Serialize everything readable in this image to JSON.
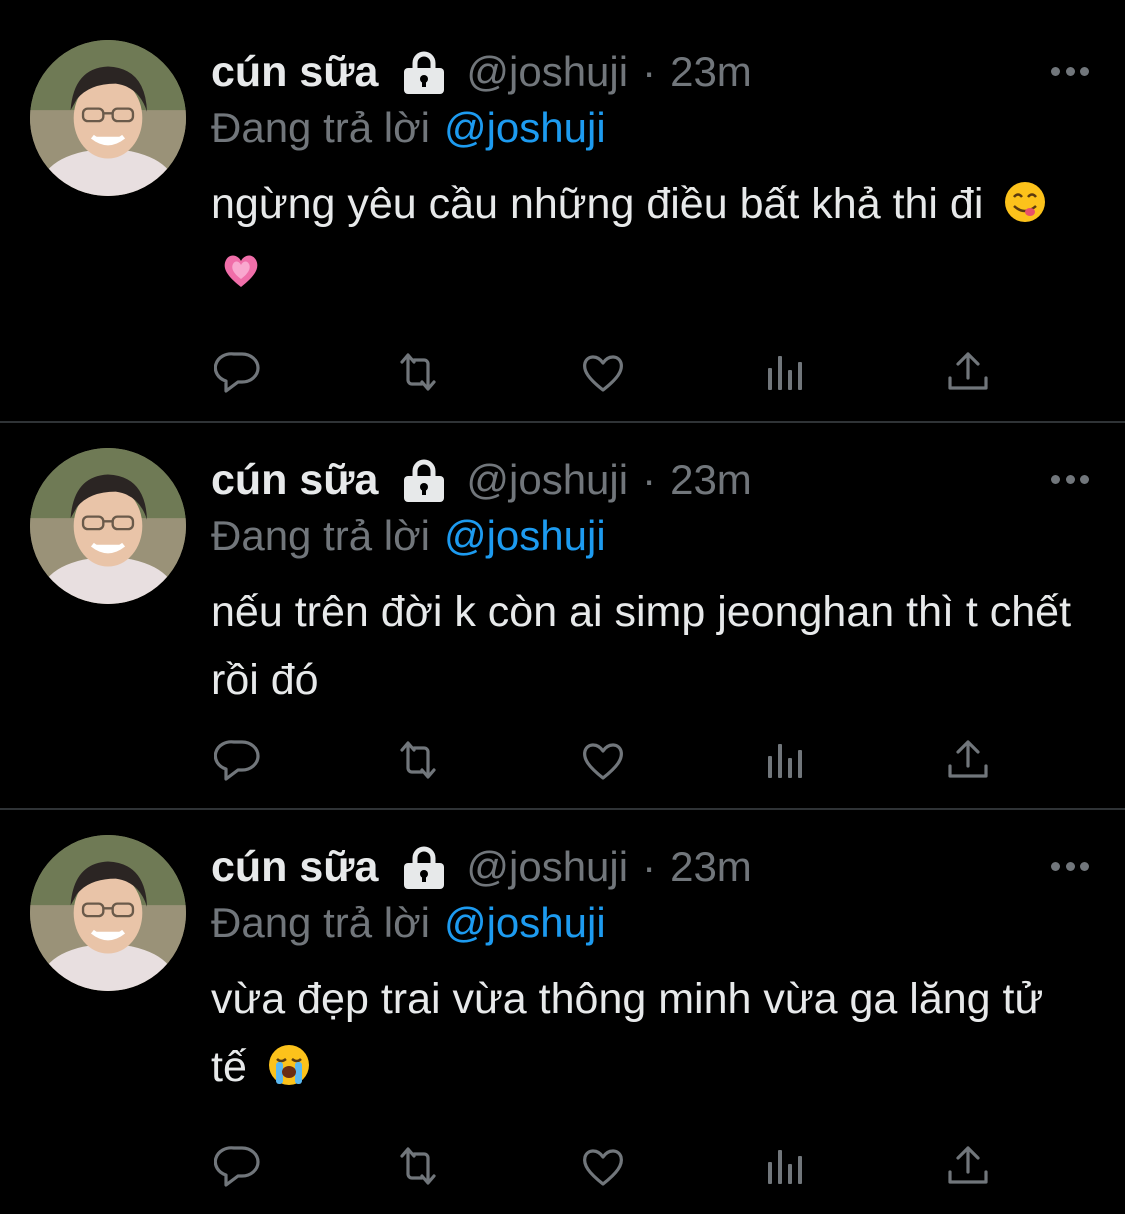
{
  "tweets": [
    {
      "display_name": "cún sữa",
      "handle": "@joshuji",
      "separator": "·",
      "time": "23m",
      "reply_prefix": "Đang trả lời",
      "reply_to": "@joshuji",
      "text": "ngừng yêu cầu những điều bất khả thi đi",
      "emojis": [
        "yum-face-emoji",
        "growing-heart-emoji"
      ]
    },
    {
      "display_name": "cún sữa",
      "handle": "@joshuji",
      "separator": "·",
      "time": "23m",
      "reply_prefix": "Đang trả lời",
      "reply_to": "@joshuji",
      "text": "nếu trên đời k còn ai simp jeonghan thì t chết rồi đó",
      "emojis": []
    },
    {
      "display_name": "cún sữa",
      "handle": "@joshuji",
      "separator": "·",
      "time": "23m",
      "reply_prefix": "Đang trả lời",
      "reply_to": "@joshuji",
      "text": "vừa đẹp trai vừa thông minh vừa ga lăng tử tế",
      "emojis": [
        "loudly-crying-face-emoji"
      ]
    }
  ],
  "icons": {
    "lock": "lock-icon",
    "more": "more-icon",
    "reply": "reply-icon",
    "retweet": "retweet-icon",
    "like": "heart-icon",
    "views": "views-icon",
    "share": "share-icon"
  },
  "colors": {
    "background": "#000000",
    "text_primary": "#e7e9ea",
    "text_secondary": "#71767b",
    "link": "#1d9bf0",
    "divider": "#2f3336"
  }
}
